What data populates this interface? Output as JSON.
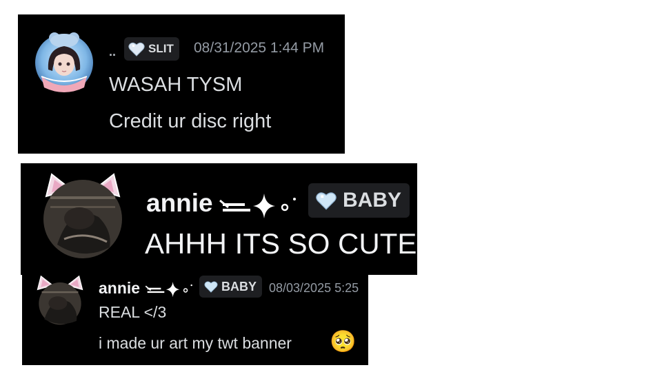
{
  "messages": [
    {
      "author": "..",
      "role_tag": "SLIT",
      "timestamp": "08/31/2025 1:44 PM",
      "lines": [
        "WASAH TYSM",
        "Credit ur disc right"
      ],
      "avatar_icon": "anime-girl-avatar",
      "tag_icon": "heart-icon"
    },
    {
      "author": "annie",
      "role_tag": "BABY",
      "lines": [
        "AHHH ITS SO CUTE"
      ],
      "avatar_icon": "cat-ear-avatar",
      "tag_icon": "heart-icon"
    },
    {
      "author": "annie",
      "role_tag": "BABY",
      "timestamp": "08/03/2025 5:25",
      "lines": [
        "REAL </3",
        "i made ur art my twt banner"
      ],
      "avatar_icon": "cat-ear-avatar",
      "tag_icon": "heart-icon",
      "emoji": "🥺"
    }
  ],
  "colors": {
    "background": "#000000",
    "text": "#f2f3f5",
    "muted": "#949ba4",
    "tag_bg": "#1e1f22",
    "heart": "#cfe3f5"
  }
}
